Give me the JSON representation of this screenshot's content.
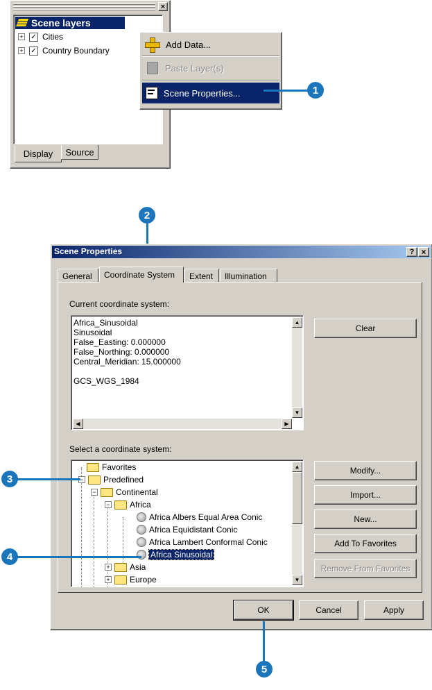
{
  "toc": {
    "title": "Scene layers",
    "layers": [
      {
        "label": "Cities",
        "checked": true
      },
      {
        "label": "Country Boundary",
        "checked": true
      }
    ],
    "tabs": [
      "Display",
      "Source"
    ],
    "close_glyph": "×"
  },
  "context_menu": {
    "items": [
      {
        "label": "Add Data...",
        "enabled": true,
        "icon": "add-data-icon"
      },
      {
        "label": "Paste Layer(s)",
        "enabled": false,
        "icon": "paste-icon"
      },
      {
        "label": "Scene Properties...",
        "enabled": true,
        "highlighted": true,
        "icon": "properties-icon"
      }
    ]
  },
  "callouts": [
    "1",
    "2",
    "3",
    "4",
    "5"
  ],
  "dialog": {
    "title": "Scene Properties",
    "title_buttons": [
      "?",
      "×"
    ],
    "tabs": [
      "General",
      "Coordinate System",
      "Extent",
      "Illumination"
    ],
    "active_tab": "Coordinate System",
    "current_label": "Current coordinate system:",
    "current_lines": [
      "Africa_Sinusoidal",
      "Sinusoidal",
      "False_Easting: 0.000000",
      "False_Northing: 0.000000",
      "Central_Meridian: 15.000000",
      "",
      "GCS_WGS_1984"
    ],
    "clear_label": "Clear",
    "select_label": "Select a coordinate system:",
    "tree": [
      {
        "label": "Favorites",
        "kind": "folder",
        "level": 0
      },
      {
        "label": "Predefined",
        "kind": "folder",
        "level": 0,
        "expander": "−"
      },
      {
        "label": "Continental",
        "kind": "folder",
        "level": 1,
        "expander": "−"
      },
      {
        "label": "Africa",
        "kind": "folder",
        "level": 2,
        "expander": "−"
      },
      {
        "label": "Africa Albers Equal Area Conic",
        "kind": "globe",
        "level": 3
      },
      {
        "label": "Africa Equidistant Conic",
        "kind": "globe",
        "level": 3
      },
      {
        "label": "Africa Lambert Conformal Conic",
        "kind": "globe",
        "level": 3
      },
      {
        "label": "Africa Sinusoidal",
        "kind": "globe",
        "level": 3,
        "selected": true
      },
      {
        "label": "Asia",
        "kind": "folder",
        "level": 2,
        "expander": "+"
      },
      {
        "label": "Europe",
        "kind": "folder",
        "level": 2,
        "expander": "+"
      }
    ],
    "side_buttons": [
      {
        "label": "Modify...",
        "enabled": true
      },
      {
        "label": "Import...",
        "enabled": true
      },
      {
        "label": "New...",
        "enabled": true
      },
      {
        "label": "Add To Favorites",
        "enabled": true
      },
      {
        "label": "Remove From Favorites",
        "enabled": false
      }
    ],
    "footer_buttons": [
      "OK",
      "Cancel",
      "Apply"
    ]
  },
  "colors": {
    "callout": "#1b75bb",
    "title_bar": "#0a246a",
    "highlight": "#0a246a",
    "face": "#d4d0c8"
  }
}
